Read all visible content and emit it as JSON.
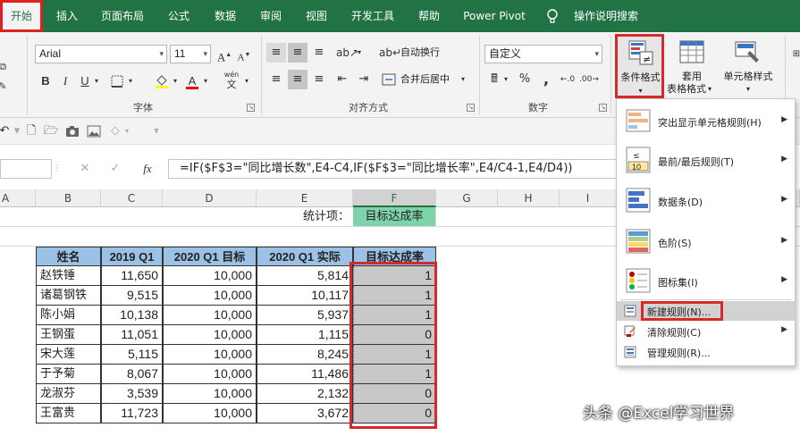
{
  "tabs": [
    "开始",
    "插入",
    "页面布局",
    "公式",
    "数据",
    "审阅",
    "视图",
    "开发工具",
    "帮助",
    "Power Pivot",
    "操作说明搜索"
  ],
  "ribbon": {
    "font_name": "Arial",
    "font_size": "11",
    "wen_label": "wén",
    "wen_char": "文",
    "wrap_label": "自动换行",
    "merge_label": "合并后居中",
    "number_format": "自定义",
    "percent": "%",
    "comma": ",",
    "cond_format": "条件格式",
    "table_format_1": "套用",
    "table_format_2": "表格格式",
    "cell_style": "单元格样式",
    "groups": {
      "font": "字体",
      "align": "对齐方式",
      "number": "数字"
    }
  },
  "formula_bar": {
    "fx": "fx",
    "formula": "=IF($F$3=\"同比增长数\",E4-C4,IF($F$3=\"同比增长率\",E4/C4-1,E4/D4))"
  },
  "columns": [
    "A",
    "B",
    "C",
    "D",
    "E",
    "F",
    "G",
    "H",
    "I"
  ],
  "sheet": {
    "stat_label": "统计项：",
    "stat_value": "目标达成率",
    "headers": [
      "姓名",
      "2019 Q1",
      "2020 Q1 目标",
      "2020 Q1 实际",
      "目标达成率"
    ],
    "rows": [
      [
        "赵铁锤",
        "11,650",
        "10,000",
        "5,814",
        "1"
      ],
      [
        "诸葛钢铁",
        "9,515",
        "10,000",
        "10,117",
        "1"
      ],
      [
        "陈小娟",
        "10,138",
        "10,000",
        "5,937",
        "1"
      ],
      [
        "王钢蛋",
        "11,051",
        "10,000",
        "1,115",
        "0"
      ],
      [
        "宋大莲",
        "5,115",
        "10,000",
        "8,245",
        "1"
      ],
      [
        "于予菊",
        "8,067",
        "10,000",
        "11,486",
        "1"
      ],
      [
        "龙淑芬",
        "3,539",
        "10,000",
        "2,132",
        "0"
      ],
      [
        "王富贵",
        "11,723",
        "10,000",
        "3,672",
        "0"
      ]
    ]
  },
  "menu": [
    {
      "label": "突出显示单元格规则(H)",
      "icon": "highlight-rules-icon"
    },
    {
      "label": "最前/最后规则(T)",
      "icon": "top-bottom-icon"
    },
    {
      "label": "数据条(D)",
      "icon": "data-bars-icon"
    },
    {
      "label": "色阶(S)",
      "icon": "color-scales-icon"
    },
    {
      "label": "图标集(I)",
      "icon": "icon-sets-icon"
    },
    {
      "label": "新建规则(N)...",
      "icon": "new-rule-icon"
    },
    {
      "label": "清除规则(C)",
      "icon": "clear-rules-icon"
    },
    {
      "label": "管理规则(R)...",
      "icon": "manage-rules-icon"
    }
  ],
  "watermark": "头条 @Excel学习世界",
  "colors": {
    "excel_green": "#217346",
    "header_blue": "#9bc2e6",
    "highlight_red": "#d62a2a",
    "stat_green": "#7fd3a9"
  }
}
